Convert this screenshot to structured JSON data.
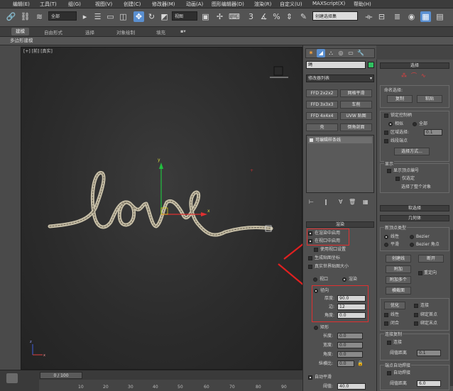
{
  "menu": {
    "items": [
      "编辑(E)",
      "工具(T)",
      "组(G)",
      "视图(V)",
      "创建(C)",
      "修改器(M)",
      "动画(A)",
      "图形编辑器(D)",
      "渲染(R)",
      "自定义(U)",
      "MAXScript(X)",
      "帮助(H)"
    ]
  },
  "toolbar": {
    "selection_filter": "全部",
    "ref_coord": "视图",
    "named_selection": "创建选择集"
  },
  "ribbon": {
    "tabs": [
      "建模",
      "自由形式",
      "选择",
      "对象绘制",
      "填充"
    ],
    "sub_label": "多边形建模"
  },
  "viewport": {
    "label": "[+] [前] [真实]",
    "text_object": "love",
    "frame_counter": "0 / 100"
  },
  "timeline": {
    "ticks": [
      "10",
      "20",
      "30",
      "40",
      "50",
      "60",
      "70",
      "80",
      "90"
    ]
  },
  "command_panel": {
    "object_name": "绳",
    "modifier_list": "修改器列表",
    "modifier_buttons": [
      "FFD 2x2x2",
      "网格平滑",
      "FFD 3x3x3",
      "车削",
      "FFD 4x4x4",
      "UVW 贴图",
      "壳",
      "倒角剖面"
    ],
    "stack_item": "可编辑样条线",
    "render_rollout": "渲染",
    "enable_in_render": "在渲染中启用",
    "enable_in_viewport": "在视口中启用",
    "use_viewport_settings": "使用视口设置",
    "generate_mapping": "生成贴图坐标",
    "real_world_map": "真实世界贴图大小",
    "viewport_radio": "视口",
    "render_radio": "渲染",
    "radial": "径向",
    "thickness_label": "厚度:",
    "thickness_value": "90.0",
    "sides_label": "边:",
    "sides_value": "12",
    "angle_label": "角度:",
    "angle_value": "0.0",
    "rectangular": "矩形",
    "length_label": "长度:",
    "length_value": "0.0",
    "width_label": "宽度:",
    "width_value": "0.0",
    "rect_angle_label": "角度:",
    "rect_angle_value": "0.0",
    "aspect_label": "纵横比:",
    "aspect_value": "0.0",
    "auto_smooth": "自动平滑",
    "threshold_label": "阈值:",
    "threshold_value": "40.0"
  },
  "right_panel": {
    "selection_rollout": "选择",
    "named_selection": "命名选择:",
    "copy": "复制",
    "paste": "粘贴",
    "lock_handles": "锁定控制柄",
    "similar": "相似",
    "all": "全部",
    "area_select": "区域选择:",
    "area_value": "0.1",
    "segment_end": "线段端点",
    "select_by": "选择方式...",
    "display": "显示",
    "show_vertex_numbers": "显示顶点编号",
    "only_selected": "仅选定",
    "selected_count": "选择了整个对象",
    "soft_selection": "软选择",
    "geometry": "几何体",
    "new_vertex_type": "新顶点类型",
    "linear": "线性",
    "bezier": "Bezier",
    "smooth": "平滑",
    "bezier_corner": "Bezier 角点",
    "create_line": "创建线",
    "break": "断开",
    "attach": "附加",
    "reorient": "重定向",
    "attach_multiple": "附加多个",
    "cross_section": "横截面",
    "refine": "优化",
    "connect": "连接",
    "linear_chk": "线性",
    "bind_first": "绑定首点",
    "closed": "闭合",
    "bind_last": "绑定末点",
    "connect_copy": "连接复制",
    "connect_chk": "连接",
    "threshold_label": "阈值距离",
    "threshold_value": "0.1",
    "end_auto_weld": "端点自动焊接",
    "auto_weld": "自动焊接",
    "weld_threshold_label": "阈值距离",
    "weld_threshold_value": "6.0"
  }
}
